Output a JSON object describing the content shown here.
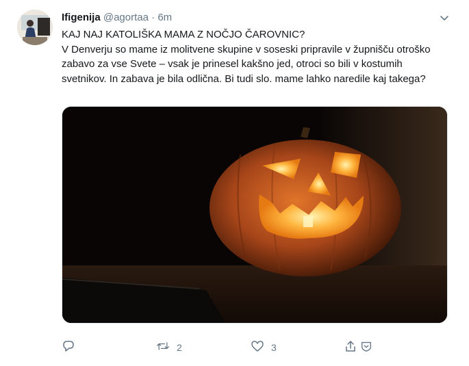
{
  "tweet": {
    "display_name": "Ifigenija",
    "handle": "@agortaa",
    "separator": "·",
    "time": "6m",
    "title_line": "KAJ NAJ KATOLIŠKA MAMA Z NOČJO ČAROVNIC?",
    "body": "V Denverju so mame iz molitvene skupine v soseski pripravile v župnišču otroško zabavo za vse Svete – vsak je prinesel kakšno jed, otroci so bili v kostumih svetnikov. In zabava je bila odlična. Bi tudi slo. mame lahko naredile kaj takega?"
  },
  "actions": {
    "reply_count": "",
    "retweet_count": "2",
    "like_count": "3"
  },
  "colors": {
    "text": "#14171a",
    "secondary": "#657786",
    "pumpkin": "#c4561a",
    "glow": "#ffb347"
  }
}
